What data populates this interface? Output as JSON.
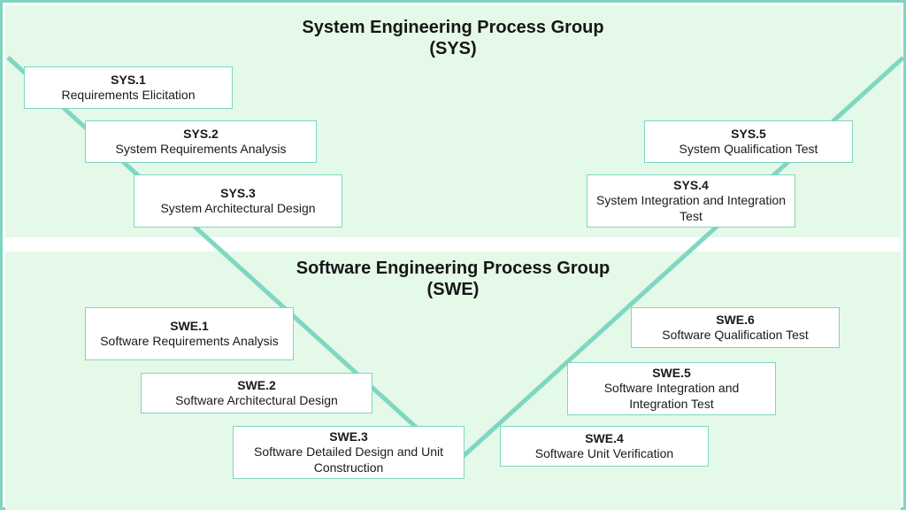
{
  "groups": {
    "sys": {
      "title_line1": "System Engineering Process Group",
      "title_line2": "(SYS)"
    },
    "swe": {
      "title_line1": "Software Engineering Process Group",
      "title_line2": "(SWE)"
    }
  },
  "boxes": {
    "sys1": {
      "code": "SYS.1",
      "label": "Requirements Elicitation"
    },
    "sys2": {
      "code": "SYS.2",
      "label": "System Requirements Analysis"
    },
    "sys3": {
      "code": "SYS.3",
      "label": "System Architectural Design"
    },
    "sys4": {
      "code": "SYS.4",
      "label": "System Integration and Integration Test"
    },
    "sys5": {
      "code": "SYS.5",
      "label": "System Qualification Test"
    },
    "swe1": {
      "code": "SWE.1",
      "label": "Software Requirements Analysis"
    },
    "swe2": {
      "code": "SWE.2",
      "label": "Software Architectural Design"
    },
    "swe3": {
      "code": "SWE.3",
      "label": "Software Detailed Design and Unit Construction"
    },
    "swe4": {
      "code": "SWE.4",
      "label": "Software Unit Verification"
    },
    "swe5": {
      "code": "SWE.5",
      "label": "Software Integration and Integration Test"
    },
    "swe6": {
      "code": "SWE.6",
      "label": "Software Qualification Test"
    }
  },
  "colors": {
    "panel_bg": "#e5f9e8",
    "border": "#7fd6c0",
    "v_line": "#80d7c1"
  }
}
